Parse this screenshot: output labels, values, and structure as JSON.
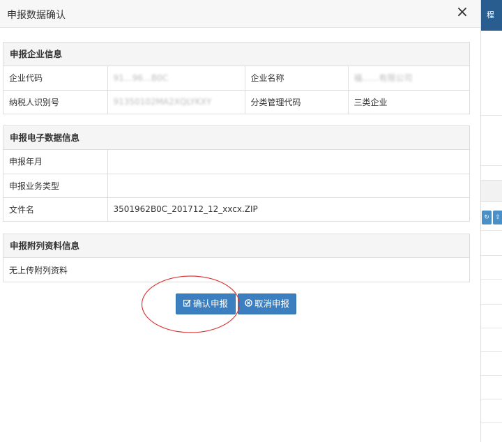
{
  "dialog": {
    "title": "申报数据确认",
    "close_glyph": "×"
  },
  "company_panel": {
    "heading": "申报企业信息",
    "rows": [
      [
        "企业代码",
        "91…96…B0C",
        "企业名称",
        "福……有限公司"
      ],
      [
        "纳税人识别号",
        "91350102MA2XQLYKXY",
        "分类管理代码",
        "三类企业"
      ]
    ]
  },
  "edata_panel": {
    "heading": "申报电子数据信息",
    "rows": [
      [
        "申报年月",
        ""
      ],
      [
        "申报业务类型",
        ""
      ],
      [
        "文件名",
        "3501962B0C_201712_12_xxcx.ZIP"
      ]
    ]
  },
  "attach_panel": {
    "heading": "申报附列资料信息",
    "text": "无上传附列资料"
  },
  "buttons": {
    "confirm_label": "确认申报",
    "confirm_icon": "edit-check-icon",
    "cancel_label": "取消申报",
    "cancel_icon": "circle-x-icon"
  },
  "background": {
    "header_text": "程",
    "btn_icons": [
      "refresh-icon",
      "upload-icon"
    ]
  },
  "colors": {
    "button": "#3c7fc0",
    "annotation": "#d9393b",
    "bg_header": "#2a5d8f"
  }
}
